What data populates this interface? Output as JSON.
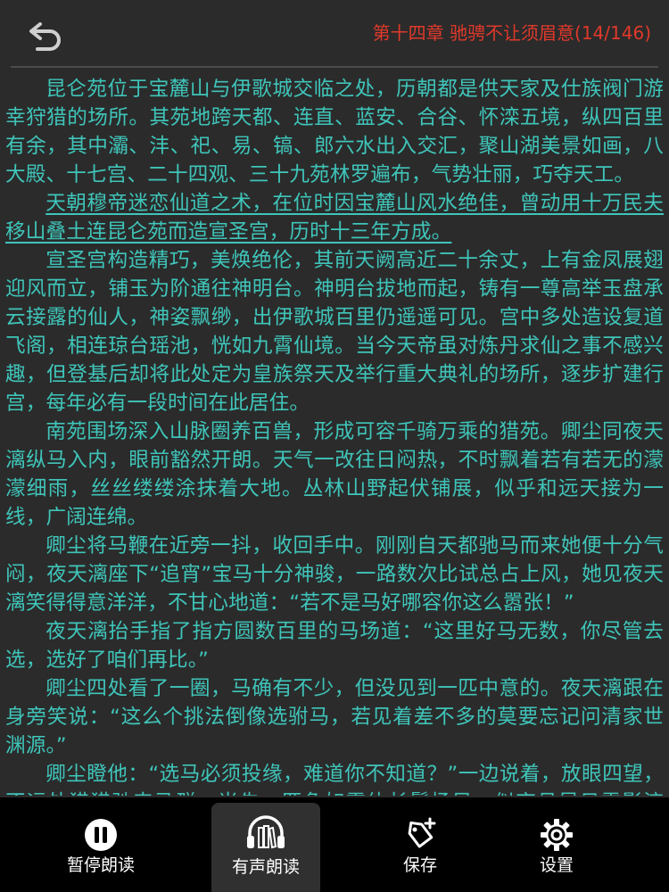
{
  "header": {
    "chapter_title": "第十四章 驰骋不让须眉意(14/146)"
  },
  "content": {
    "paragraphs": [
      "昆仑苑位于宝麓山与伊歌城交临之处，历朝都是供天家及仕族阀门游幸狩猎的场所。其苑地跨天都、连直、蓝安、合谷、怀滦五境，纵四百里有余，其中灞、沣、祀、易、镐、郎六水出入交汇，聚山湖美景如画，八大殿、十七宫、二十四观、三十九苑林罗遍布，气势壮丽，巧夺天工。",
      "天朝穆帝迷恋仙道之术，在位时因宝麓山风水绝佳，曾动用十万民夫移山叠土连昆仑苑而造宣圣宫，历时十三年方成。",
      "宣圣宫构造精巧，美焕绝伦，其前天阙高近二十余丈，上有金凤展翅迎风而立，铺玉为阶通往神明台。神明台拔地而起，铸有一尊高举玉盘承云接露的仙人，神姿飘缈，出伊歌城百里仍遥遥可见。宫中多处造设复道飞阁，相连琼台瑶池，恍如九霄仙境。当今天帝虽对炼丹求仙之事不感兴趣，但登基后却将此处定为皇族祭天及举行重大典礼的场所，逐步扩建行宫，每年必有一段时间在此居住。",
      "南苑围场深入山脉圈养百兽，形成可容千骑万乘的猎苑。卿尘同夜天漓纵马入内，眼前豁然开朗。天气一改往日闷热，不时飘着若有若无的濛濛细雨，丝丝缕缕涂抹着大地。丛林山野起伏铺展，似乎和远天接为一线，广阔连绵。",
      "卿尘将马鞭在近旁一抖，收回手中。刚刚自天都驰马而来她便十分气闷，夜天漓座下“追宵”宝马十分神骏，一路数次比试总占上风，她见夜天漓笑得得意洋洋，不甘心地道：“若不是马好哪容你这么嚣张！”",
      "夜天漓抬手指了指方圆数百里的马场道：“这里好马无数，你尽管去选，选好了咱们再比。”",
      "卿尘四处看了一圈，马确有不少，但没见到一匹中意的。夜天漓跟在身旁笑说：“这么个挑法倒像选驸马，若见着差不多的莫要忘记问清家世渊源。”",
      "卿尘瞪他：“选马必须投缘，难道你不知道？”一边说着，放眼四望，不远处猎猎驰来马群，当先一匹色如霜纨长鬓扬风，似夜月昼日雪影流光，自油绿原野迎面飞奔而来。像是奔驰的尽兴，那马冠领诸骑，缓步停下，奕奕双眼桀骜不驯，傲气十足地往这边看来。人马站着相望，卿尘眼睑是意：“就是那匹！”"
    ]
  },
  "toolbar": {
    "pause_label": "暂停朗读",
    "audio_label": "有声朗读",
    "save_label": "保存",
    "settings_label": "设置"
  },
  "icons": {
    "back": "back-arrow-icon",
    "pause": "pause-circle-icon",
    "audio": "headphones-book-icon",
    "save": "bookmark-tag-plus-icon",
    "settings": "gear-icon"
  },
  "colors": {
    "text": "#3fc5ba",
    "title": "#e0392b",
    "background": "#2b2b2b"
  }
}
